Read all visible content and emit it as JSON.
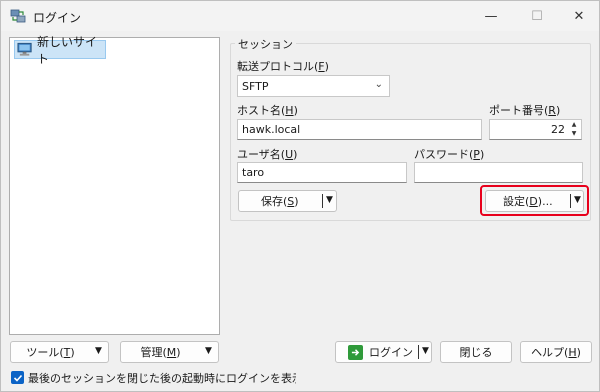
{
  "window": {
    "title": "ログイン",
    "controls": {
      "minimize": "—",
      "maximize": "☐",
      "close": "✕"
    }
  },
  "site_tree": {
    "items": [
      {
        "label": "新しいサイト",
        "icon": "computer-icon",
        "selected": true
      }
    ]
  },
  "session": {
    "group_label": "セッション",
    "protocol": {
      "label_main": "転送プロトコル(",
      "label_key": "F",
      "label_end": ")",
      "value": "SFTP"
    },
    "host": {
      "label_main": "ホスト名(",
      "label_key": "H",
      "label_end": ")",
      "value": "hawk.local"
    },
    "port": {
      "label_main": "ポート番号(",
      "label_key": "R",
      "label_end": ")",
      "value": "22"
    },
    "user": {
      "label_main": "ユーザ名(",
      "label_key": "U",
      "label_end": ")",
      "value": "taro"
    },
    "password": {
      "label_main": "パスワード(",
      "label_key": "P",
      "label_end": ")",
      "value": ""
    },
    "save_button": {
      "label_main": "保存(",
      "label_key": "S",
      "label_end": ")"
    },
    "advanced_button": {
      "label_main": "設定(",
      "label_key": "D",
      "label_end": ")..."
    }
  },
  "bottom": {
    "tools_button": {
      "label_main": "ツール(",
      "label_key": "T",
      "label_end": ")"
    },
    "manage_button": {
      "label_main": "管理(",
      "label_key": "M",
      "label_end": ")"
    },
    "login_button": {
      "label": "ログイン"
    },
    "close_button": {
      "label": "閉じる"
    },
    "help_button": {
      "label_main": "ヘルプ(",
      "label_key": "H",
      "label_end": ")"
    },
    "show_login_checkbox": {
      "checked": true,
      "label": "最後のセッションを閉じた後の起動時にログインを表示(S"
    }
  },
  "colors": {
    "accent": "#0b63c6",
    "highlight_border": "#e8001c",
    "selection": "#cce4f7",
    "login_icon": "#2f9a3a"
  }
}
